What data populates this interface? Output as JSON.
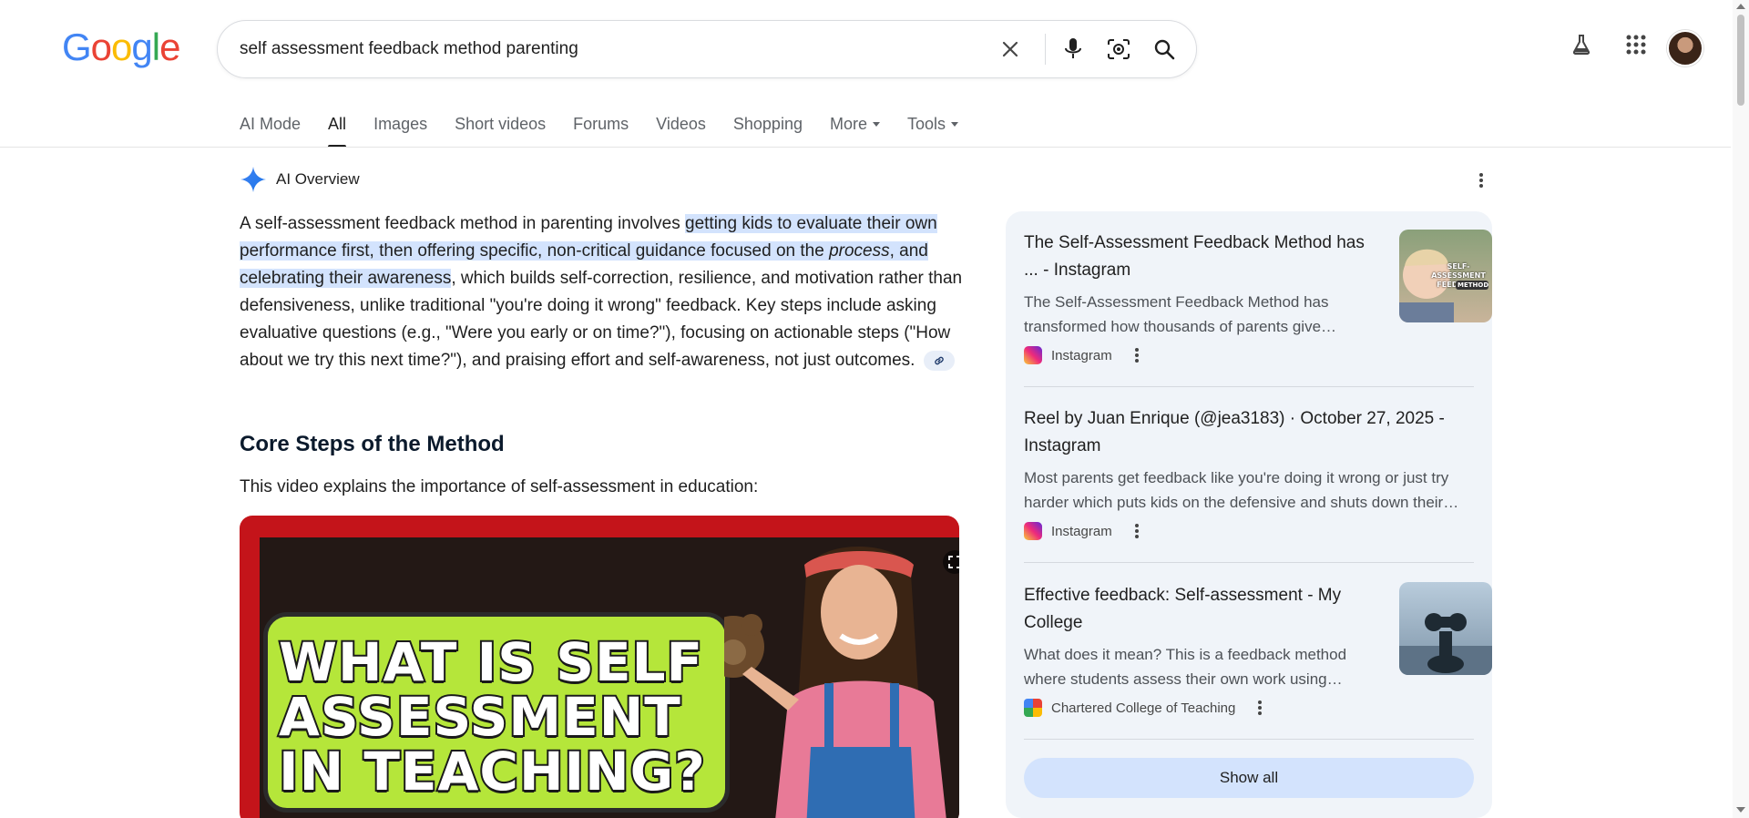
{
  "logo": {
    "letters": [
      "G",
      "o",
      "o",
      "g",
      "l",
      "e"
    ]
  },
  "search": {
    "query": "self assessment feedback method parenting",
    "icons": [
      "clear-icon",
      "microphone-icon",
      "google-lens-icon",
      "search-icon"
    ]
  },
  "header_icons": [
    "labs-flask-icon",
    "apps-grid-icon",
    "account-avatar"
  ],
  "tabs": [
    {
      "label": "AI Mode",
      "active": false
    },
    {
      "label": "All",
      "active": true
    },
    {
      "label": "Images",
      "active": false
    },
    {
      "label": "Short videos",
      "active": false
    },
    {
      "label": "Forums",
      "active": false
    },
    {
      "label": "Videos",
      "active": false
    },
    {
      "label": "Shopping",
      "active": false
    },
    {
      "label": "More",
      "active": false,
      "dropdown": true
    },
    {
      "label": "Tools",
      "active": false,
      "dropdown": true
    }
  ],
  "ai_overview": {
    "title": "AI Overview",
    "p_part1": "A self-assessment feedback method in parenting involves ",
    "p_highlight1": "getting kids to evaluate their own performance first, then offering specific, non-critical guidance focused on the ",
    "p_highlight_italic": "process",
    "p_highlight2": ", and celebrating their awareness",
    "p_part2": ", which builds self-correction, resilience, and motivation rather than defensiveness, unlike traditional \"you're doing it wrong\" feedback. Key steps include asking evaluative questions (e.g., \"Were you early or on time?\"), focusing on actionable steps (\"How about we try this next time?\"), and praising effort and self-awareness, not just outcomes.",
    "core_heading": "Core Steps of the Method",
    "video_intro": "This video explains the importance of self-assessment in education:",
    "video_title_lines": [
      "WHAT IS SELF",
      "ASSESSMENT",
      "IN TEACHING?"
    ]
  },
  "sources": [
    {
      "title": "The Self-Assessment Feedback Method has ... - Instagram",
      "description": "The Self-Assessment Feedback Method has transformed how thousands of parents give…",
      "site": "Instagram",
      "thumb_text": [
        "SELF-ASSESSMENT FEEDBACK",
        "METHOD"
      ]
    },
    {
      "title": "Reel by Juan Enrique (@jea3183) · October 27, 2025 - Instagram",
      "description": "Most parents get feedback like you're doing it wrong or just try harder which puts kids on the defensive and shuts down their…",
      "site": "Instagram"
    },
    {
      "title": "Effective feedback: Self-assessment - My College",
      "description": "What does it mean? This is a feedback method where students assess their own work using…",
      "site": "Chartered College of Teaching"
    }
  ],
  "show_all_label": "Show all",
  "colors": {
    "highlight": "#d3e3fd",
    "panel_bg": "#f0f4f9",
    "video_frame": "#c4141a",
    "video_title_bg": "#b5e63a"
  }
}
